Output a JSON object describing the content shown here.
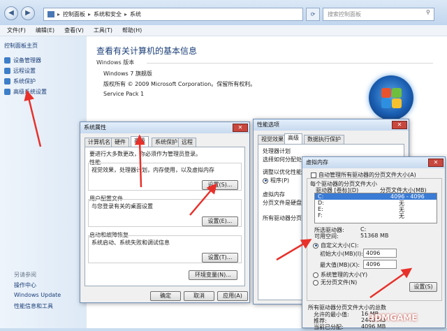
{
  "explorer": {
    "breadcrumb": [
      "控制面板",
      "系统和安全",
      "系统"
    ],
    "search_placeholder": "搜索控制面板",
    "menu": [
      "文件(F)",
      "编辑(E)",
      "查看(V)",
      "工具(T)",
      "帮助(H)"
    ],
    "sidebar": {
      "home": "控制面板主页",
      "items": [
        "设备管理器",
        "远程设置",
        "系统保护",
        "高级系统设置"
      ],
      "see_also_title": "另请参阅",
      "see_also": [
        "操作中心",
        "Windows Update",
        "性能信息和工具"
      ]
    },
    "content": {
      "title": "查看有关计算机的基本信息",
      "edition_label": "Windows 版本",
      "edition": "Windows 7 旗舰版",
      "copyright": "版权所有 © 2009 Microsoft Corporation。保留所有权利。",
      "service_pack": "Service Pack 1"
    }
  },
  "sysprops": {
    "title": "系统属性",
    "tabs": [
      "计算机名",
      "硬件",
      "高级",
      "系统保护",
      "远程"
    ],
    "note": "要进行大多数更改，你必须作为管理员登录。",
    "perf_title": "性能",
    "perf_desc": "视觉效果，处理器计划，内存使用，以及虚拟内存",
    "profile_title": "用户配置文件",
    "profile_desc": "与您登录有关的桌面设置",
    "startup_title": "启动和故障恢复",
    "startup_desc": "系统启动、系统失败和调试信息",
    "settings_btn": "设置(S)...",
    "settings_btn2": "设置(E)...",
    "settings_btn3": "设置(T)...",
    "env_btn": "环境变量(N)...",
    "ok": "确定",
    "cancel": "取消",
    "apply": "应用(A)"
  },
  "perfopts": {
    "title": "性能选项",
    "tabs": [
      "视觉效果",
      "高级",
      "数据执行保护"
    ],
    "sched_title": "处理器计划",
    "sched_desc": "选择如何分配处",
    "adjust": "调整以优化性能",
    "program": "程序(P)",
    "vm_title": "虚拟内存",
    "vm_desc1": "分页文件是硬盘",
    "vm_desc2": "所有驱动器分页"
  },
  "virtmem": {
    "title": "虚拟内存",
    "auto": "自动管理所有驱动器的分页文件大小(A)",
    "each_drive": "每个驱动器的分页文件大小",
    "col_drive": "驱动器 [卷标](D)",
    "col_size": "分页文件大小(MB)",
    "drives": [
      {
        "drive": "C:",
        "size": "4096 - 4096"
      },
      {
        "drive": "D:",
        "size": "无"
      },
      {
        "drive": "E:",
        "size": "无"
      },
      {
        "drive": "F:",
        "size": "无"
      }
    ],
    "sel_drive_label": "所选驱动器:",
    "sel_drive": "C:",
    "free_label": "可用空间:",
    "free": "51368 MB",
    "custom": "自定义大小(C):",
    "initial_label": "初始大小(MB)(I):",
    "initial": "4096",
    "max_label": "最大值(MB)(X):",
    "max": "4096",
    "sys_managed": "系统管理的大小(Y)",
    "no_paging": "无分页文件(N)",
    "set_btn": "设置(S)",
    "total_title": "所有驱动器分页文件大小的总数",
    "min_label": "允许的最小值:",
    "min": "16 MB",
    "rec_label": "推荐:",
    "rec": "2448 MB",
    "cur_label": "当前已分配:",
    "cur": "4096 MB"
  },
  "watermark": "3DMGAME"
}
